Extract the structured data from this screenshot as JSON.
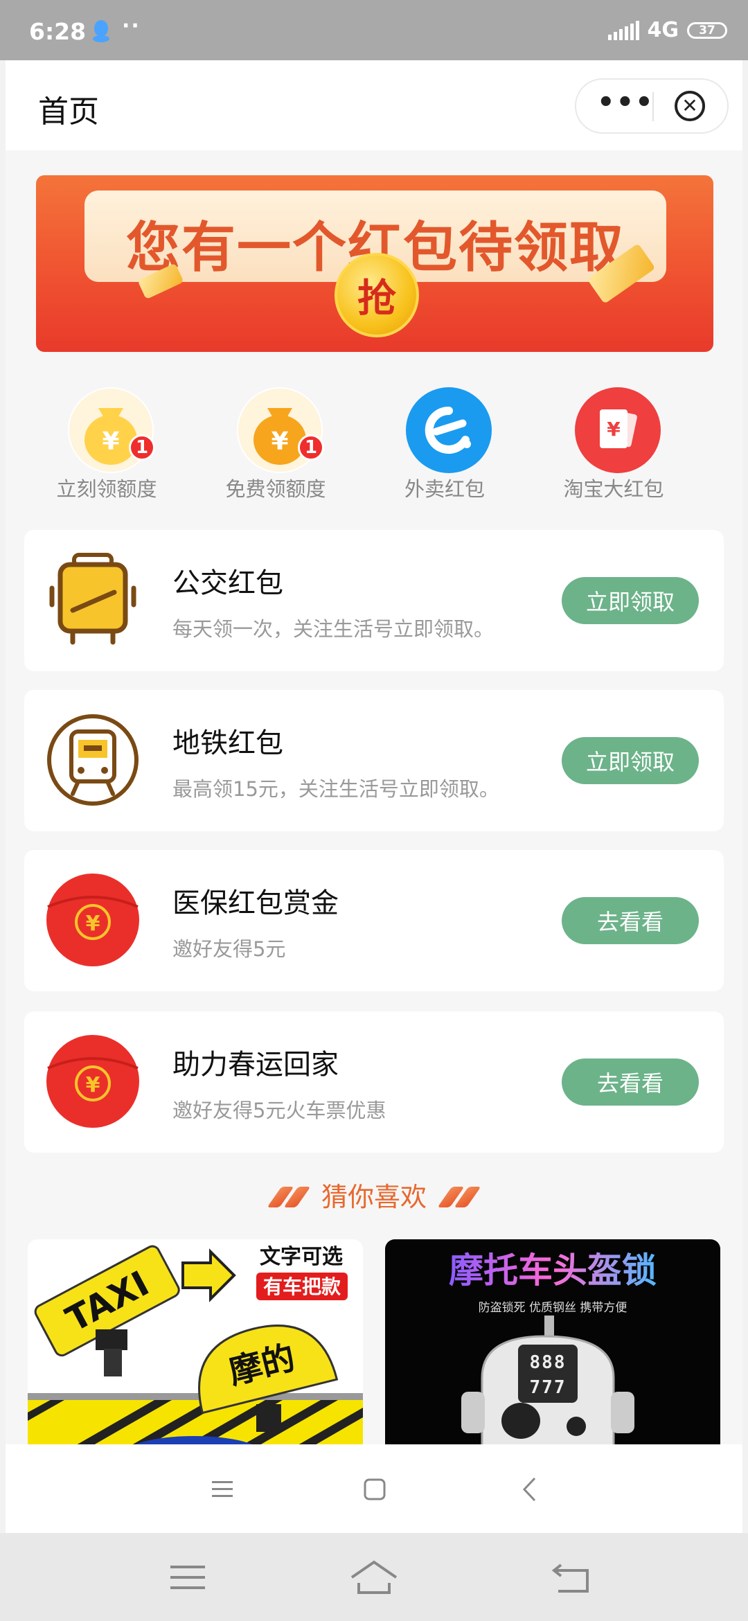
{
  "status_bar": {
    "time": "6:28",
    "network": "4G",
    "battery": "37"
  },
  "title_bar": {
    "title": "首页"
  },
  "banner": {
    "text": "您有一个红包待领取",
    "coin_text": "抢"
  },
  "icon_row": [
    {
      "label": "立刻领额度",
      "icon": "money-bag-icon",
      "badge": "1"
    },
    {
      "label": "免费领额度",
      "icon": "money-bag-icon",
      "badge": "1"
    },
    {
      "label": "外卖红包",
      "icon": "eleme-icon"
    },
    {
      "label": "淘宝大红包",
      "icon": "red-envelope-icon"
    }
  ],
  "cards": [
    {
      "title": "公交红包",
      "subtitle": "每天领一次，关注生活号立即领取。",
      "button": "立即领取",
      "icon": "bus-icon"
    },
    {
      "title": "地铁红包",
      "subtitle": "最高领15元，关注生活号立即领取。",
      "button": "立即领取",
      "icon": "subway-icon"
    },
    {
      "title": "医保红包赏金",
      "subtitle": "邀好友得5元",
      "button": "去看看",
      "icon": "yuan-coin-icon"
    },
    {
      "title": "助力春运回家",
      "subtitle": "邀好友得5元火车票优惠",
      "button": "去看看",
      "icon": "yuan-coin-icon"
    }
  ],
  "guess_section": {
    "title": "猜你喜欢"
  },
  "products": [
    {
      "sign_text": "TAXI",
      "dome_text": "摩的",
      "tag1": "文字可选",
      "tag2": "有车把款"
    },
    {
      "title": "摩托车头盔锁",
      "features": "防盗锁死  优质钢丝  携带方便",
      "dial": "888",
      "dial2": "777"
    }
  ],
  "colors": {
    "button_green": "#6cb38a",
    "accent_orange": "#e8682e",
    "banner_red": "#ef5030"
  }
}
